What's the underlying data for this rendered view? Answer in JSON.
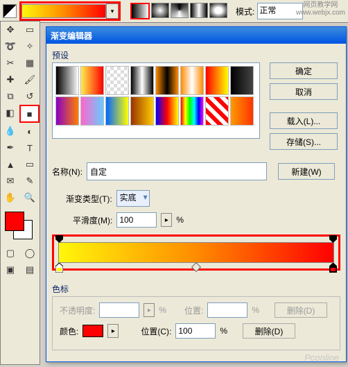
{
  "toolbar": {
    "mode_label": "模式:",
    "mode_value": "正常",
    "watermark_line1": "网页教学网",
    "watermark_line2": "www.webjx.com"
  },
  "toolbox": {
    "fg_color": "#ff0000",
    "bg_color": "#ffffff"
  },
  "dialog": {
    "title": "渐变编辑器",
    "presets_label": "预设",
    "buttons": {
      "ok": "确定",
      "cancel": "取消",
      "load": "载入(L)...",
      "save": "存储(S)..."
    },
    "name_label": "名称(N):",
    "name_value": "自定",
    "new_btn": "新建(W)",
    "type_label": "渐变类型(T):",
    "type_value": "实底",
    "smooth_label": "平滑度(M):",
    "smooth_value": "100",
    "smooth_unit": "%",
    "stops_label": "色标",
    "opacity_label": "不透明度:",
    "opacity_unit": "%",
    "position_label": "位置:",
    "position_unit": "%",
    "color_label": "颜色:",
    "stop_color": "#ff0000",
    "position_c_label": "位置(C):",
    "position_c_value": "100",
    "delete_btn": "删除(D)"
  },
  "watermark_bottom": "Pconline",
  "gradient_presets": [
    "linear-gradient(90deg,#000,#fff)",
    "linear-gradient(90deg,#ffed4a,#ff0000)",
    "repeating-conic-gradient(#fff 0 25%,#ddd 0 50%) 50%/10px 10px",
    "linear-gradient(90deg,#000,#fff,#000)",
    "linear-gradient(90deg,#ff8c00,#000,#ff8c00)",
    "linear-gradient(90deg,#ff8c00,#fff,#ff8c00)",
    "linear-gradient(90deg,#ff0000,#ffff00)",
    "linear-gradient(90deg,#000,#444)",
    "linear-gradient(90deg,#8a00c4,#ff7f00)",
    "linear-gradient(90deg,#ff66cc,#66ccff)",
    "linear-gradient(90deg,#0066ff,#ffff00)",
    "linear-gradient(90deg,#993300,#ffcc00)",
    "linear-gradient(90deg,#0000ff,#ff0000,#ffff00)",
    "linear-gradient(90deg,#ff0000,#ffff00,#00ff00,#00ffff,#0000ff,#ff00ff)",
    "repeating-linear-gradient(45deg,#ff0000 0 6px,#fff 6px 12px)",
    "linear-gradient(90deg,#ff9900,#ff3300)"
  ],
  "chart_data": {
    "type": "gradient",
    "title": "自定",
    "stops": [
      {
        "position": 0,
        "color": "#fff70a",
        "opacity": 100
      },
      {
        "position": 100,
        "color": "#ff0000",
        "opacity": 100
      }
    ],
    "midpoint": 50,
    "smoothness": 100,
    "gradient_type": "实底"
  }
}
